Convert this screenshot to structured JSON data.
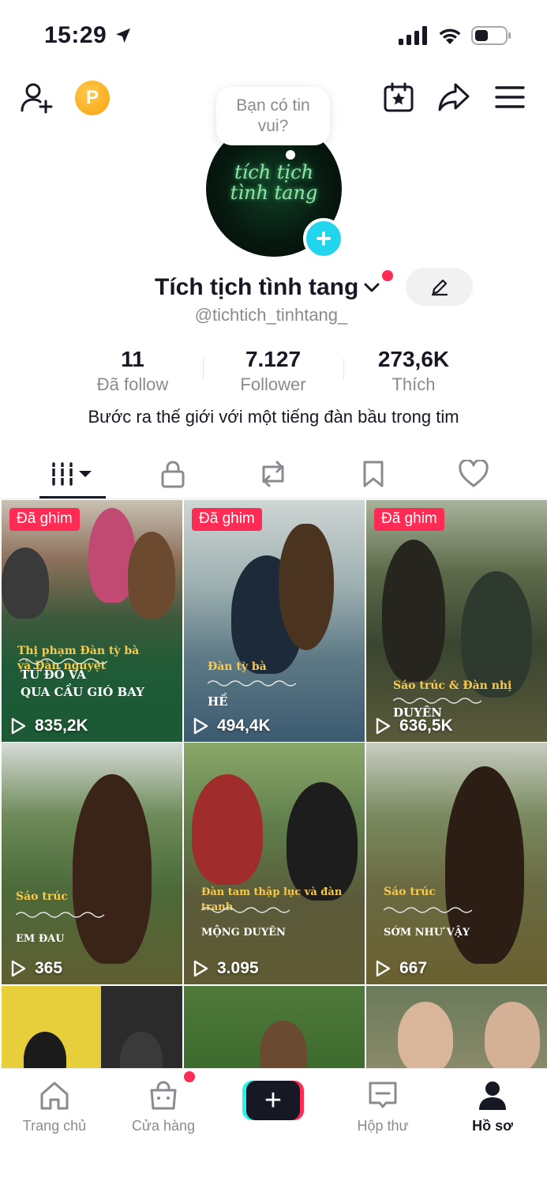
{
  "status_bar": {
    "time": "15:29"
  },
  "top_bar": {
    "coin_label": "P"
  },
  "profile": {
    "bubble_text_line1": "Bạn có tin",
    "bubble_text_line2": "vui?",
    "avatar_text_line1": "tích tịch",
    "avatar_text_line2": "tình tang",
    "display_name": "Tích tịch tình tang",
    "handle": "@tichtich_tinhtang_",
    "bio": "Bước ra thế giới với một tiếng đàn bầu trong tim"
  },
  "stats": [
    {
      "value": "11",
      "label": "Đã follow"
    },
    {
      "value": "7.127",
      "label": "Follower"
    },
    {
      "value": "273,6K",
      "label": "Thích"
    }
  ],
  "tabs": [
    {
      "name": "videos",
      "icon": "grid-icon",
      "active": true
    },
    {
      "name": "private",
      "icon": "lock-icon"
    },
    {
      "name": "reposts",
      "icon": "repost-icon"
    },
    {
      "name": "saved",
      "icon": "bookmark-icon"
    },
    {
      "name": "liked",
      "icon": "heart-icon"
    }
  ],
  "videos": [
    {
      "pinned": "Đã ghim",
      "caption1_line1": "Thị phạm Đàn tỳ bà",
      "caption1_line2": "và Đàn nguyệt",
      "caption2_line1": "TỪ ĐÓ VÀ",
      "caption2_line2": "QUA CẦU GIÓ BAY",
      "views": "835,2K"
    },
    {
      "pinned": "Đã ghim",
      "caption1_line1": "Đàn tỳ bà",
      "caption2_line1": "HỀ",
      "views": "494,4K"
    },
    {
      "pinned": "Đã ghim",
      "caption1_line1": "Sáo trúc & Đàn nhị",
      "caption2_line1": "DUYÊN",
      "views": "636,5K"
    },
    {
      "caption1_line1": "Sáo trúc",
      "caption2_line1": "EM ĐAU",
      "views": "365"
    },
    {
      "caption1_line1": "Đàn tam thập lục và đàn tranh",
      "caption2_line1": "MỘNG DUYÊN",
      "views": "3.095"
    },
    {
      "caption1_line1": "Sáo trúc",
      "caption2_line1": "SỚM NHƯ VẬY",
      "views": "667"
    }
  ],
  "bottom_nav": [
    {
      "label": "Trang chủ",
      "icon": "home-icon"
    },
    {
      "label": "Cửa hàng",
      "icon": "shop-icon"
    },
    {
      "label": "",
      "icon": "create-icon"
    },
    {
      "label": "Hộp thư",
      "icon": "inbox-icon"
    },
    {
      "label": "Hồ sơ",
      "icon": "profile-icon",
      "active": true
    }
  ],
  "colors": {
    "accent": "#fe2c55",
    "cyan": "#25f4ee",
    "caption_gold": "#f7c94d",
    "plus_blue": "#20d5ec"
  }
}
